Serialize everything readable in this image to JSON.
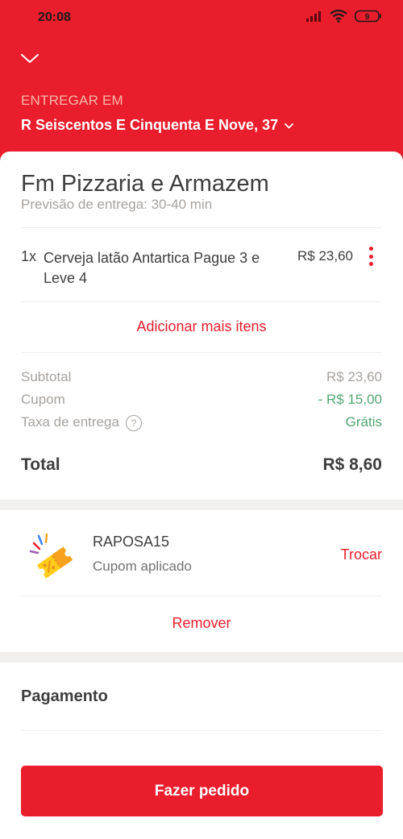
{
  "status_bar": {
    "time": "20:08",
    "battery": "9"
  },
  "header": {
    "deliver_label": "ENTREGAR EM",
    "address": "R Seiscentos E Cinquenta E Nove, 37"
  },
  "store": {
    "name": "Fm Pizzaria e Armazem",
    "eta": "Previsão de entrega: 30-40 min"
  },
  "items": [
    {
      "qty": "1x",
      "name": "Cerveja latão Antartica Pague 3 e Leve 4",
      "price": "R$ 23,60"
    }
  ],
  "add_more_label": "Adicionar mais itens",
  "summary": {
    "subtotal_label": "Subtotal",
    "subtotal_value": "R$ 23,60",
    "coupon_label": "Cupom",
    "coupon_value": "- R$ 15,00",
    "delivery_label": "Taxa de entrega",
    "delivery_value": "Grátis",
    "help_symbol": "?",
    "total_label": "Total",
    "total_value": "R$ 8,60"
  },
  "coupon": {
    "code": "RAPOSA15",
    "status": "Cupom aplicado",
    "swap_label": "Trocar",
    "remove_label": "Remover"
  },
  "payment": {
    "title": "Pagamento"
  },
  "order_button_label": "Fazer pedido",
  "colors": {
    "brand_red": "#ea1d2c",
    "success_green": "#50a773",
    "muted_text": "#a6a29f",
    "primary_text": "#3e3e3e"
  }
}
